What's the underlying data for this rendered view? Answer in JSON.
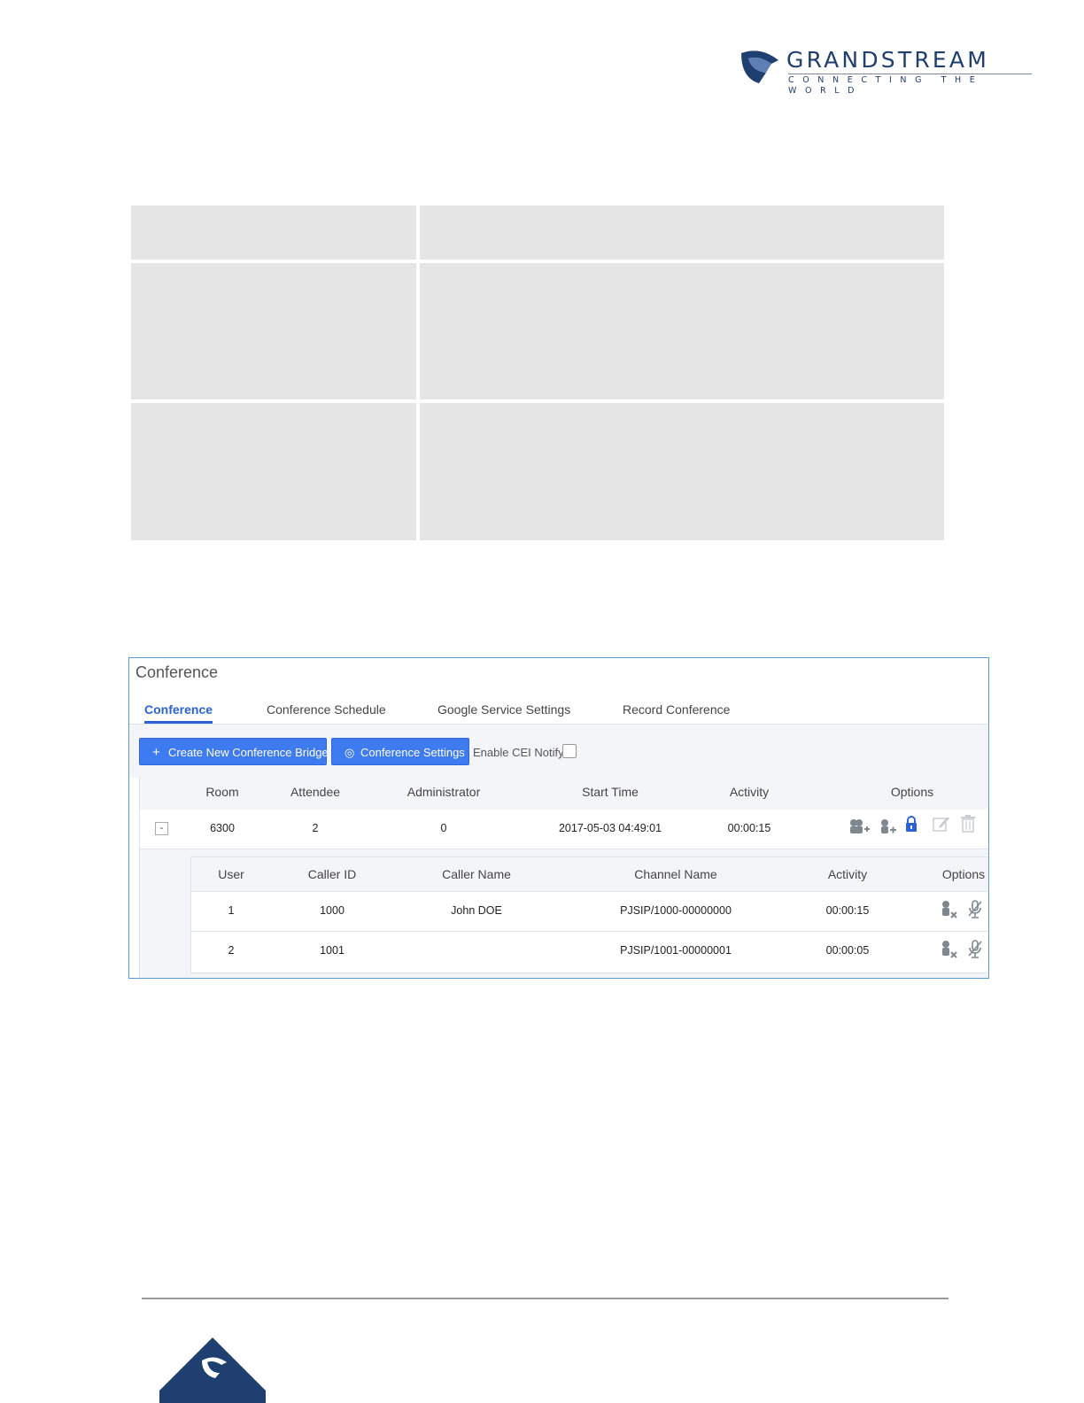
{
  "header": {
    "brand_name": "GRANDSTREAM",
    "tagline": "CONNECTING THE WORLD",
    "brand_color": "#1e3f6f",
    "logo_icon": "grandstream-logo-icon"
  },
  "panel": {
    "title": "Conference",
    "tabs": [
      {
        "label": "Conference",
        "active": true
      },
      {
        "label": "Conference Schedule",
        "active": false
      },
      {
        "label": "Google Service Settings",
        "active": false
      },
      {
        "label": "Record Conference",
        "active": false
      }
    ],
    "toolbar": {
      "create_button": "Create New Conference Bridge",
      "create_icon": "plus-icon",
      "settings_button": "Conference Settings",
      "settings_icon": "gear-icon",
      "cei_label": "Enable CEI Notify",
      "cei_checked": false,
      "accent_color": "#3f7bf0"
    },
    "rooms_table": {
      "headers": [
        "Room",
        "Attendee",
        "Administrator",
        "Start Time",
        "Activity",
        "Options"
      ],
      "rows": [
        {
          "expand_symbol": "-",
          "room": "6300",
          "attendee": "2",
          "administrator": "0",
          "start_time": "2017-05-03 04:49:01",
          "activity": "00:00:15",
          "options": [
            "invite-participants-icon",
            "invite-participant-icon",
            "lock-icon",
            "edit-icon",
            "delete-icon"
          ]
        }
      ]
    },
    "attendees_table": {
      "headers": [
        "User",
        "Caller ID",
        "Caller Name",
        "Channel Name",
        "Activity",
        "Options"
      ],
      "rows": [
        {
          "user": "1",
          "caller_id": "1000",
          "caller_name": "John DOE",
          "channel_name": "PJSIP/1000-00000000",
          "activity": "00:00:15",
          "options": [
            "kick-user-icon",
            "mute-icon"
          ]
        },
        {
          "user": "2",
          "caller_id": "1001",
          "caller_name": "",
          "channel_name": "PJSIP/1001-00000001",
          "activity": "00:00:05",
          "options": [
            "kick-user-icon",
            "mute-icon"
          ]
        }
      ]
    }
  }
}
